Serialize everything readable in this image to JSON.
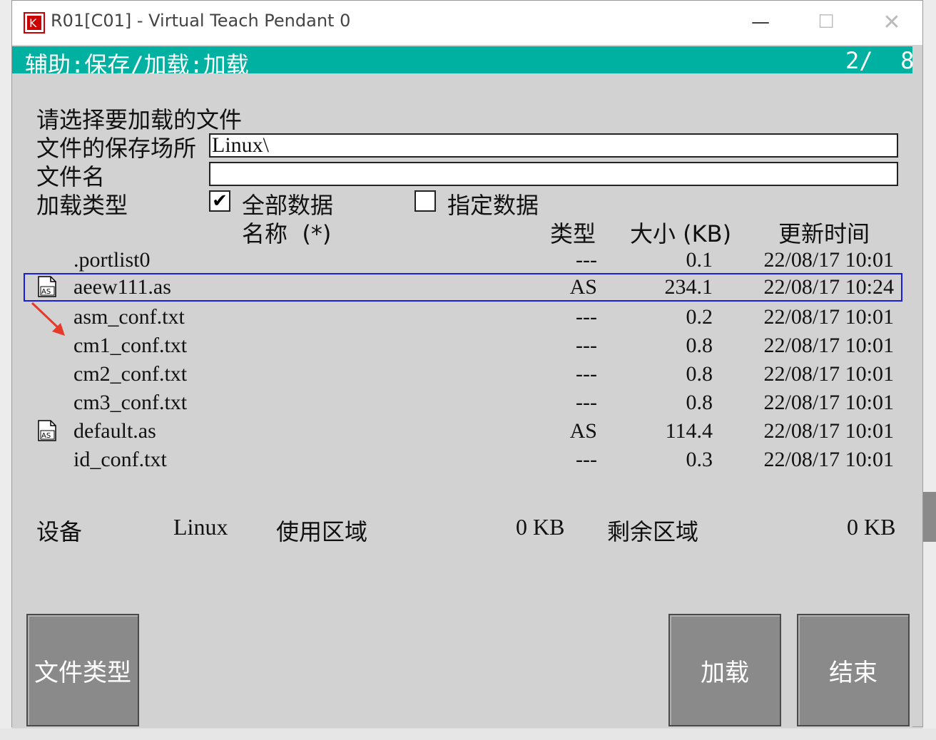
{
  "window": {
    "title": "R01[C01] - Virtual Teach Pendant 0",
    "minimize_glyph": "—",
    "maximize_glyph": "☐",
    "close_glyph": "✕"
  },
  "header": {
    "title": "辅助:保存/加载:加载",
    "page": "2/  8"
  },
  "form": {
    "prompt": "请选择要加载的文件",
    "location_label": "文件的保存场所",
    "location_value": "Linux\\",
    "filename_label": "文件名",
    "filename_value": "",
    "load_type_label": "加载类型",
    "all_data_label": "全部数据",
    "all_data_checked": true,
    "specified_data_label": "指定数据",
    "specified_data_checked": false,
    "check_glyph": "✔"
  },
  "table": {
    "headers": {
      "name": "名称  (*)",
      "type": "类型",
      "size": "大小 (KB)",
      "time": "更新时间"
    },
    "rows": [
      {
        "icon": "",
        "name": ".portlist0",
        "type": "---",
        "size": "0.1",
        "time": "22/08/17 10:01",
        "selected": false
      },
      {
        "icon": "AS",
        "name": "aeew111.as",
        "type": "AS",
        "size": "234.1",
        "time": "22/08/17 10:24",
        "selected": true
      },
      {
        "icon": "",
        "name": "asm_conf.txt",
        "type": "---",
        "size": "0.2",
        "time": "22/08/17 10:01",
        "selected": false
      },
      {
        "icon": "",
        "name": "cm1_conf.txt",
        "type": "---",
        "size": "0.8",
        "time": "22/08/17 10:01",
        "selected": false
      },
      {
        "icon": "",
        "name": "cm2_conf.txt",
        "type": "---",
        "size": "0.8",
        "time": "22/08/17 10:01",
        "selected": false
      },
      {
        "icon": "",
        "name": "cm3_conf.txt",
        "type": "---",
        "size": "0.8",
        "time": "22/08/17 10:01",
        "selected": false
      },
      {
        "icon": "AS",
        "name": "default.as",
        "type": "AS",
        "size": "114.4",
        "time": "22/08/17 10:01",
        "selected": false
      },
      {
        "icon": "",
        "name": "id_conf.txt",
        "type": "---",
        "size": "0.3",
        "time": "22/08/17 10:01",
        "selected": false
      }
    ]
  },
  "status": {
    "device_label": "设备",
    "device_value": "Linux",
    "used_label": "使用区域",
    "used_value": "0 KB",
    "free_label": "剩余区域",
    "free_value": "0 KB"
  },
  "buttons": {
    "file_type": "文件类型",
    "load": "加载",
    "end": "结束"
  },
  "colors": {
    "header_bg": "#00b0a0",
    "selection_border": "#1c1ce0",
    "annotation_arrow": "#e53a2a"
  }
}
